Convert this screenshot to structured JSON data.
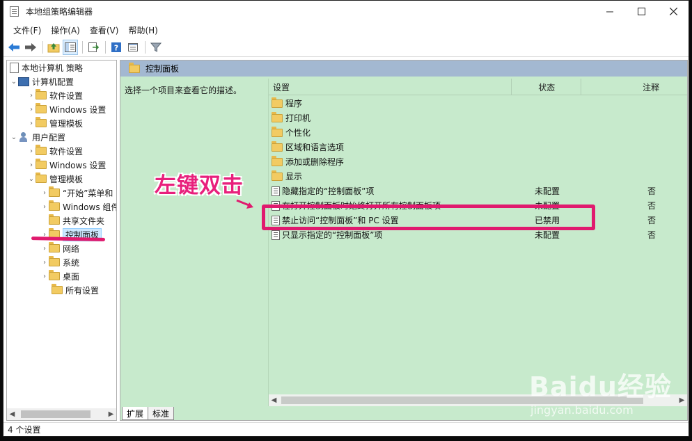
{
  "window": {
    "title": "本地组策略编辑器"
  },
  "menubar": {
    "items": [
      "文件(F)",
      "操作(A)",
      "查看(V)",
      "帮助(H)"
    ]
  },
  "tree": {
    "root": "本地计算机 策略",
    "computer_config": "计算机配置",
    "software_settings_1": "软件设置",
    "windows_settings_1": "Windows 设置",
    "admin_templates_1": "管理模板",
    "user_config": "用户配置",
    "software_settings_2": "软件设置",
    "windows_settings_2": "Windows 设置",
    "admin_templates_2": "管理模板",
    "start_menu": "“开始”菜单和",
    "windows_components": "Windows 组件",
    "shared_folders": "共享文件夹",
    "control_panel": "控制面板",
    "network": "网络",
    "system": "系统",
    "desktop": "桌面",
    "all_settings": "所有设置"
  },
  "right": {
    "header": "控制面板",
    "description": "选择一个项目来查看它的描述。",
    "columns": {
      "setting": "设置",
      "state": "状态",
      "note": "注释"
    },
    "folders": [
      "程序",
      "打印机",
      "个性化",
      "区域和语言选项",
      "添加或删除程序",
      "显示"
    ],
    "settings": [
      {
        "name": "隐藏指定的“控制面板”项",
        "state": "未配置",
        "note": "否"
      },
      {
        "name": "在打开控制面板时始终打开所有控制面板项",
        "state": "未配置",
        "note": "否"
      },
      {
        "name": "禁止访问“控制面板”和 PC 设置",
        "state": "已禁用",
        "note": "否"
      },
      {
        "name": "只显示指定的“控制面板”项",
        "state": "未配置",
        "note": "否"
      }
    ]
  },
  "tabs": {
    "extended": "扩展",
    "standard": "标准"
  },
  "status": {
    "text": "4 个设置"
  },
  "annotation": {
    "text": "左键双击",
    "color": "#e01a6e"
  },
  "watermark": {
    "main": "Baidu经验",
    "sub": "jingyan.baidu.com"
  }
}
